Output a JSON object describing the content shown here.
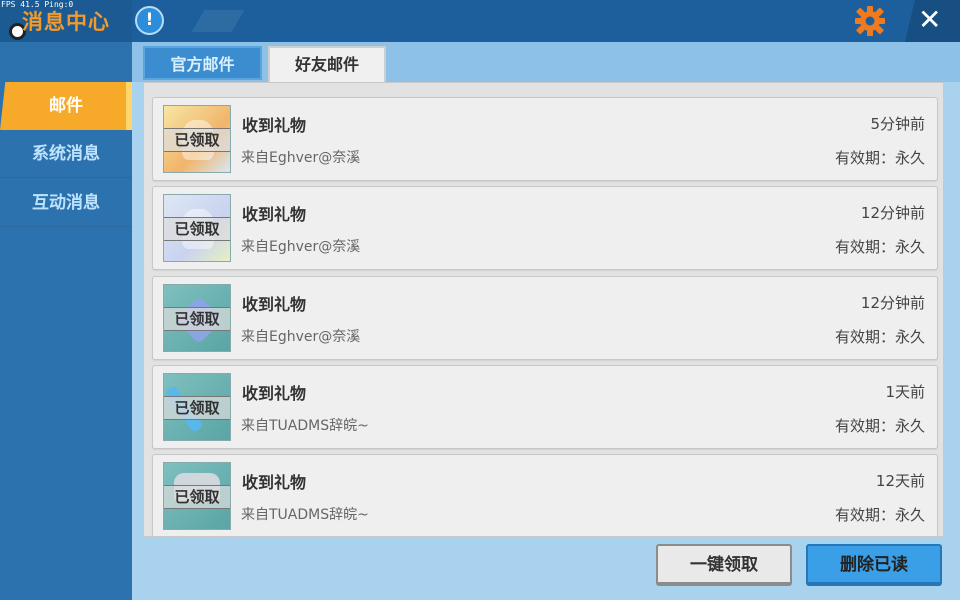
{
  "status_overlay": {
    "text": "FPS 41.5  Ping:0"
  },
  "header": {
    "title": "消息中心",
    "info_label": "!",
    "close_label": "✕"
  },
  "sidebar": {
    "items": [
      {
        "label": "邮件",
        "active": true
      },
      {
        "label": "系统消息",
        "active": false
      },
      {
        "label": "互动消息",
        "active": false
      }
    ]
  },
  "tabs": [
    {
      "label": "官方邮件",
      "active": false
    },
    {
      "label": "好友邮件",
      "active": true
    }
  ],
  "mails": [
    {
      "title": "收到礼物",
      "from": "来自Eghver@奈溪",
      "time": "5分钟前",
      "validity": "有效期：永久",
      "status": "已领取",
      "icon": "anime-character-portrait-icon"
    },
    {
      "title": "收到礼物",
      "from": "来自Eghver@奈溪",
      "time": "12分钟前",
      "validity": "有效期：永久",
      "status": "已领取",
      "icon": "white-hair-character-portrait-icon"
    },
    {
      "title": "收到礼物",
      "from": "来自Eghver@奈溪",
      "time": "12分钟前",
      "validity": "有效期：永久",
      "status": "已领取",
      "icon": "crystal-gem-icon"
    },
    {
      "title": "收到礼物",
      "from": "来自TUADMS辞皖~",
      "time": "1天前",
      "validity": "有效期：永久",
      "status": "已领取",
      "icon": "ice-sword-icon"
    },
    {
      "title": "收到礼物",
      "from": "来自TUADMS辞皖~",
      "time": "12天前",
      "validity": "有效期：永久",
      "status": "已领取",
      "icon": "hammer-icon"
    }
  ],
  "footer": {
    "claim_all_label": "一键领取",
    "delete_read_label": "删除已读"
  },
  "colors": {
    "accent_orange": "#f7a92a",
    "header_blue": "#1c5f9c",
    "button_blue": "#3a9fe6"
  }
}
